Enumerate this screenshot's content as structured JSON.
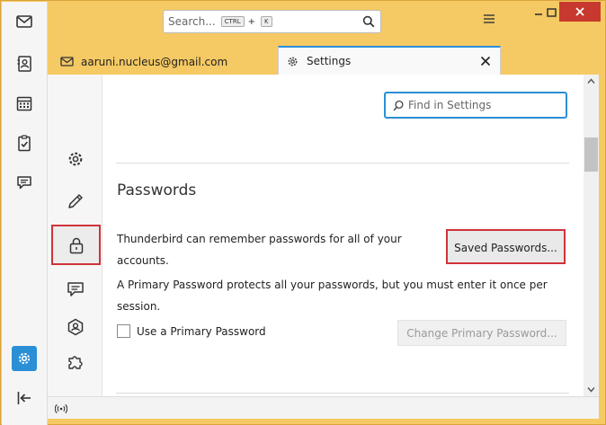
{
  "titlebar": {
    "search_placeholder": "Search...",
    "kbd_ctrl": "CTRL",
    "kbd_plus": "+",
    "kbd_k": "K"
  },
  "tabs": [
    {
      "label": "aaruni.nucleus@gmail.com",
      "icon": "mail-icon"
    },
    {
      "label": "Settings",
      "icon": "gear-icon",
      "active": true
    }
  ],
  "settings": {
    "find_placeholder": "Find in Settings",
    "section_title": "Passwords",
    "remember_text": "Thunderbird can remember passwords for all of your accounts.",
    "saved_passwords_label": "Saved Passwords...",
    "primary_text": "A Primary Password protects all your passwords, but you must enter it once per session.",
    "use_primary_label": "Use a Primary Password",
    "use_primary_checked": false,
    "change_primary_label": "Change Primary Password..."
  },
  "colors": {
    "accent": "#2b8fd6",
    "highlight_red": "#d0333a",
    "titlebar": "#f5c963"
  }
}
